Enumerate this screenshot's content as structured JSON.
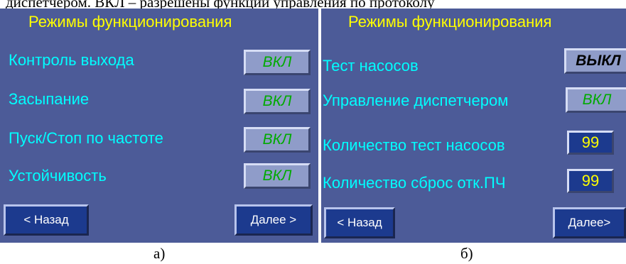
{
  "document": {
    "top_text": "диспетчером. ВКЛ – разрешены функции управления по протоколу",
    "caption_a": "а)",
    "caption_b": "б)"
  },
  "panel_a": {
    "title": "Режимы функционирования",
    "rows": [
      {
        "label": "Контроль выхода",
        "state": "ВКЛ"
      },
      {
        "label": "Засыпание",
        "state": "ВКЛ"
      },
      {
        "label": "Пуск/Стоп по частоте",
        "state": "ВКЛ"
      },
      {
        "label": "Устойчивость",
        "state": "ВКЛ"
      }
    ],
    "back_label": "< Назад",
    "next_label": "Далее >"
  },
  "panel_b": {
    "title": "Режимы функционирования",
    "rows": [
      {
        "label": "Тест насосов",
        "state": "ВЫКЛ"
      },
      {
        "label": "Управление диспетчером",
        "state": "ВКЛ"
      }
    ],
    "counters": [
      {
        "label": "Количество тест насосов",
        "value": "99"
      },
      {
        "label": "Количество сброс отк.ПЧ",
        "value": "99"
      }
    ],
    "back_label": "< Назад",
    "next_label": "Далее>"
  },
  "colors": {
    "panel_bg": "#4c5b98",
    "title": "#ffff00",
    "label": "#00ffff",
    "toggle_on_text": "#00aa00",
    "toggle_off_text": "#000000",
    "value_text": "#ffff00",
    "nav_button_bg": "#1c3a8e"
  }
}
